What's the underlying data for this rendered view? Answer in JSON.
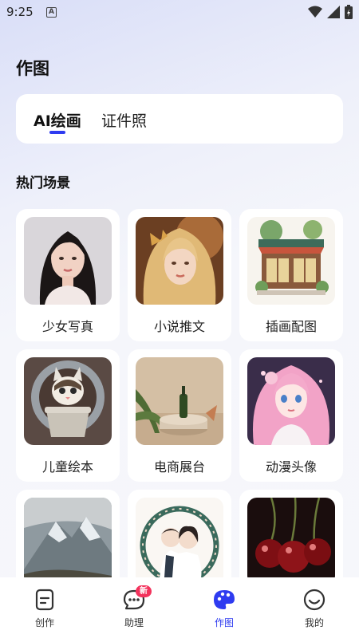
{
  "status_bar": {
    "time": "9:25",
    "notification_badge": "A"
  },
  "page": {
    "title": "作图"
  },
  "tabs": [
    {
      "label": "AI绘画",
      "active": true
    },
    {
      "label": "证件照",
      "active": false
    }
  ],
  "section": {
    "title": "热门场景"
  },
  "scenes": [
    {
      "label": "少女写真",
      "image": "portrait-girl"
    },
    {
      "label": "小说推文",
      "image": "fantasy-girl-butterfly"
    },
    {
      "label": "插画配图",
      "image": "cafe-illustration"
    },
    {
      "label": "儿童绘本",
      "image": "cartoon-cat"
    },
    {
      "label": "电商展台",
      "image": "product-stage"
    },
    {
      "label": "动漫头像",
      "image": "anime-pink-hair"
    },
    {
      "label": "",
      "image": "snowy-mountain"
    },
    {
      "label": "",
      "image": "couple-wreath"
    },
    {
      "label": "",
      "image": "cherries"
    }
  ],
  "bottom_nav": [
    {
      "label": "创作",
      "icon": "create-icon",
      "active": false
    },
    {
      "label": "助理",
      "icon": "chat-icon",
      "active": false,
      "badge": "新"
    },
    {
      "label": "作图",
      "icon": "palette-icon",
      "active": true
    },
    {
      "label": "我的",
      "icon": "smiley-icon",
      "active": false
    }
  ],
  "colors": {
    "accent": "#2e3bf0",
    "badge": "#f3325c",
    "background": "#f6f7fb"
  }
}
